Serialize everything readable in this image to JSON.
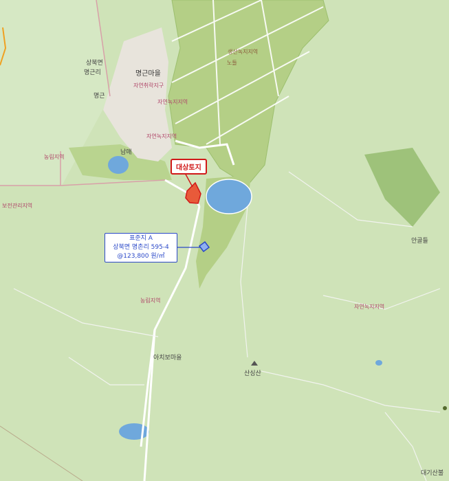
{
  "map": {
    "labels": {
      "myeonggeun_village": "명근마을",
      "sangbuk_myeon": "상북면",
      "myeonggeun_ri": "명근리",
      "myeonggeun": "명근",
      "nongdap": "남매",
      "achibo_village": "아치보마을",
      "sangsang_mountain": "산싱산",
      "angoldeul": "안골들",
      "daegi_village": "대기산불",
      "nongeop_zone": "농림지역",
      "nongeop_zone_2": "농림지역",
      "natural_green_zone": "자연녹지지역",
      "natural_green_zone_2": "자연녹지지역",
      "natural_green_zone_3": "자연녹지지역",
      "natural_green_zone_4": "자연녹지지역",
      "natural_village_district": "자연취락지구",
      "production_green_zone": "생산녹지지역",
      "no": "노들",
      "conservation_zone": "보전관리지역"
    },
    "subject": {
      "label": "대상토지",
      "color": "#d01818"
    },
    "reference": {
      "line1": "표준지 A",
      "line2": "상북면 명촌리 595-4",
      "line3": "@123,800 원/㎡",
      "color": "#2a48c8"
    },
    "colors": {
      "land": "#cfe3b8",
      "green_zone": "#b4cf86",
      "water": "#6fa8dc",
      "road": "#ffffff",
      "boundary": "#d8a0a8"
    }
  }
}
